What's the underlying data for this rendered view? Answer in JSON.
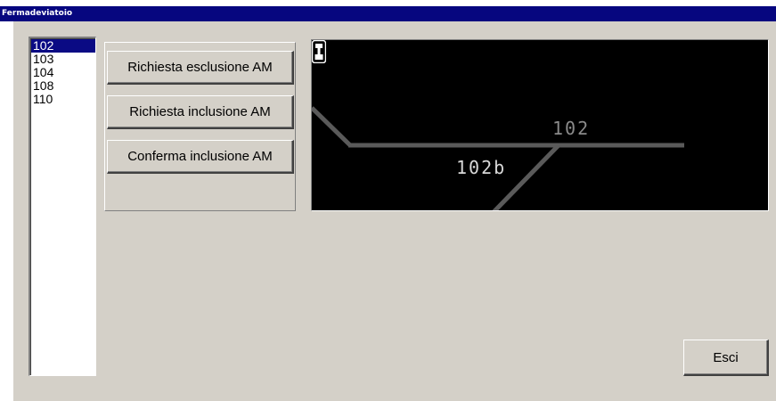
{
  "window": {
    "title": "Fermadeviatoio"
  },
  "listbox": {
    "items": [
      "102",
      "103",
      "104",
      "108",
      "110"
    ],
    "selected_index": 0
  },
  "buttons": {
    "exclusion": "Richiesta esclusione AM",
    "inclusion": "Richiesta inclusione AM",
    "confirm": "Conferma inclusione AM",
    "exit": "Esci"
  },
  "diagram": {
    "switch_label": "102",
    "branch_label": "102b",
    "signal_icon": "signal-icon",
    "colors": {
      "background": "#000000",
      "track": "#5a5a5a",
      "switch_label": "#8a8a8a",
      "branch_label": "#d8d8d8"
    }
  },
  "colors": {
    "titlebar": "#06067f",
    "dialog_bg": "#d4d0c8",
    "selection": "#0a0a84"
  }
}
